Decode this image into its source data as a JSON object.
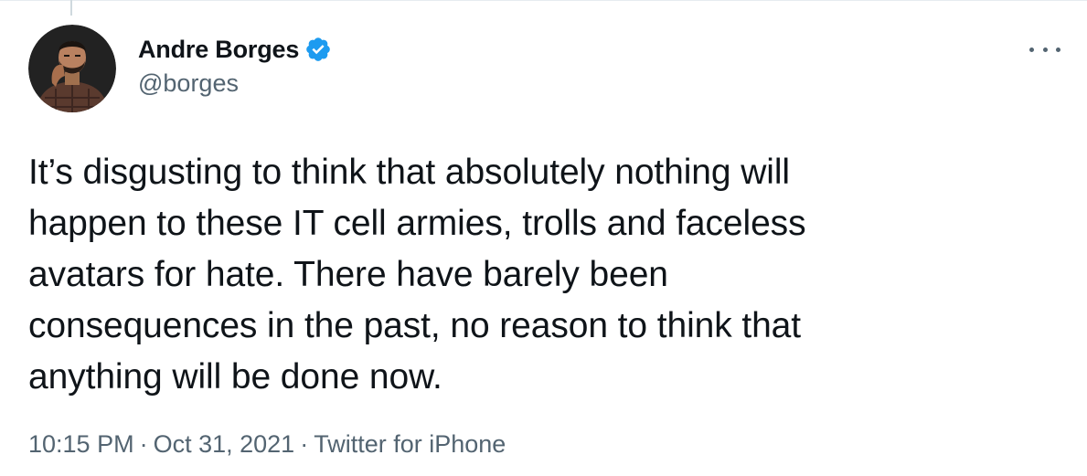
{
  "tweet": {
    "author": {
      "display_name": "Andre Borges",
      "handle": "@borges",
      "verified": true
    },
    "text_lines": [
      "It’s disgusting to think that absolutely nothing will",
      "happen to these IT cell armies, trolls and faceless",
      "avatars for hate. There have barely been",
      "consequences in the past, no reason to think that",
      "anything will be done now."
    ],
    "meta": {
      "time": "10:15 PM",
      "date": "Oct 31, 2021",
      "source": "Twitter for iPhone",
      "separator": "·"
    },
    "icons": {
      "verified": "verified-badge-icon",
      "more": "more-options-icon"
    },
    "colors": {
      "text": "#0f1419",
      "secondary": "#536471",
      "verified_blue": "#1d9bf0"
    }
  }
}
